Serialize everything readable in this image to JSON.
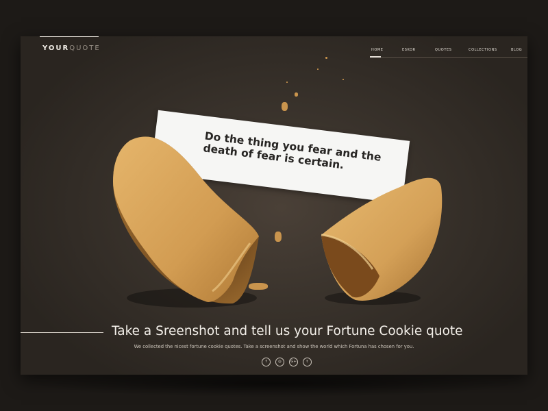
{
  "logo": {
    "part1": "YOUR",
    "part2": "QUOTE"
  },
  "nav": {
    "items": [
      {
        "label": "HOME"
      },
      {
        "label": "ESKOR"
      },
      {
        "label": "QUOTES"
      },
      {
        "label": "COLLECTIONS"
      },
      {
        "label": "BLOG"
      }
    ]
  },
  "fortune": {
    "line1": "Do the thing you fear and the",
    "line2": "death of fear is certain."
  },
  "hero": {
    "headline": "Take a Sreenshot and tell us your Fortune Cookie quote",
    "subtext": "We collected the nicest fortune cookie quotes. Take a screenshot and show the world which Fortuna has chosen for you."
  },
  "social": {
    "icons": [
      "facebook-icon",
      "instagram-icon",
      "google-plus-icon",
      "twitter-icon"
    ],
    "glyphs": [
      "f",
      "◎",
      "G+",
      "t"
    ]
  },
  "colors": {
    "background": "#3a332c",
    "cookie": "#d9a85f",
    "paper": "#f6f6f4",
    "text_light": "#f4f0ea"
  }
}
